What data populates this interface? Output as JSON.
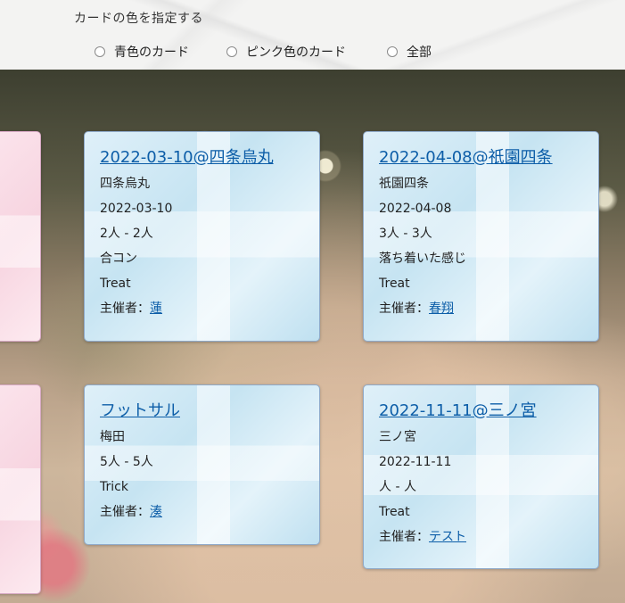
{
  "filter": {
    "title": "カードの色を指定する",
    "options": [
      {
        "label": "青色のカード",
        "selected": false
      },
      {
        "label": "ピンク色のカード",
        "selected": false
      },
      {
        "label": "全部",
        "selected": false
      }
    ]
  },
  "cards": [
    {
      "title": "2022-03-10@四条烏丸",
      "lines": [
        "四条烏丸",
        "2022-03-10",
        "2人 - 2人",
        "合コン",
        "Treat"
      ],
      "host_prefix": "主催者：",
      "host_name": "蓮"
    },
    {
      "title": "2022-04-08@祇園四条",
      "lines": [
        "祇園四条",
        "2022-04-08",
        "3人 - 3人",
        "落ち着いた感じ",
        "Treat"
      ],
      "host_prefix": "主催者：",
      "host_name": "春翔"
    },
    {
      "title": "フットサル",
      "lines": [
        "梅田",
        "5人 - 5人",
        "Trick"
      ],
      "host_prefix": "主催者：",
      "host_name": "湊"
    },
    {
      "title": "2022-11-11@三ノ宮",
      "lines": [
        "三ノ宮",
        "2022-11-11",
        "人 - 人",
        "Treat"
      ],
      "host_prefix": "主催者：",
      "host_name": "テスト"
    }
  ],
  "colors": {
    "link": "#0d5ea8",
    "card_blue": "#d3ebf6",
    "card_pink": "#fbe4ec"
  }
}
